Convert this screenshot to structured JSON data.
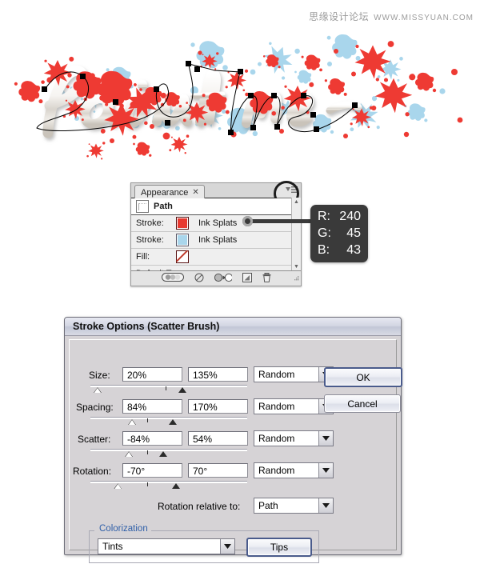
{
  "watermark": {
    "site_cn": "思缘设计论坛",
    "site_url": "WWW.MISSYUAN.COM"
  },
  "artwork": {
    "text": "Paint me",
    "style": "white-3d-script-with-ink-splats",
    "splat_red": "#ee3a33",
    "splat_blue": "#a9d6ec",
    "path_color": "#000000",
    "anchor_color": "#000000"
  },
  "appearance_panel": {
    "tab_label": "Appearance",
    "close_glyph": "✕",
    "target_label": "Path",
    "rows": [
      {
        "label": "Stroke:",
        "swatch": "#e8382f",
        "value": "Ink Splats"
      },
      {
        "label": "Stroke:",
        "swatch": "#a9d6ec",
        "value": "Ink Splats"
      },
      {
        "label": "Fill:",
        "swatch": "none",
        "value": ""
      }
    ],
    "transparency_label": "Default Transparency",
    "footer_icons": [
      "opacity-blend-icon",
      "clear-appearance-icon",
      "reduce-to-basic-appearance-icon",
      "duplicate-item-icon",
      "delete-item-icon"
    ]
  },
  "rgb_callout": {
    "r_key": "R:",
    "r_value": "240",
    "g_key": "G:",
    "g_value": "45",
    "b_key": "B:",
    "b_value": "43",
    "color_hex": "#f02d2b"
  },
  "dialog": {
    "title": "Stroke Options (Scatter Brush)",
    "fields": [
      {
        "name": "size",
        "label": "Size:",
        "min": "20%",
        "max": "135%",
        "mode": "Random",
        "slider": {
          "left_pct": 2,
          "tick_pct": 48,
          "right_pct": 56,
          "right_filled": true
        }
      },
      {
        "name": "spacing",
        "label": "Spacing:",
        "min": "84%",
        "max": "170%",
        "mode": "Random",
        "slider": {
          "left_pct": 24,
          "tick_pct": 36,
          "right_pct": 50,
          "right_filled": true
        }
      },
      {
        "name": "scatter",
        "label": "Scatter:",
        "min": "-84%",
        "max": "54%",
        "mode": "Random",
        "slider": {
          "left_pct": 22,
          "tick_pct": 36,
          "right_pct": 44,
          "right_filled": true
        }
      },
      {
        "name": "rotation",
        "label": "Rotation:",
        "min": "-70°",
        "max": "70°",
        "mode": "Random",
        "slider": {
          "left_pct": 15,
          "tick_pct": 36,
          "right_pct": 52,
          "right_filled": true
        }
      }
    ],
    "rotation_relative_label": "Rotation relative to:",
    "rotation_relative_value": "Path",
    "colorization_legend": "Colorization",
    "colorization_value": "Tints",
    "tips_label": "Tips",
    "ok_label": "OK",
    "cancel_label": "Cancel"
  }
}
